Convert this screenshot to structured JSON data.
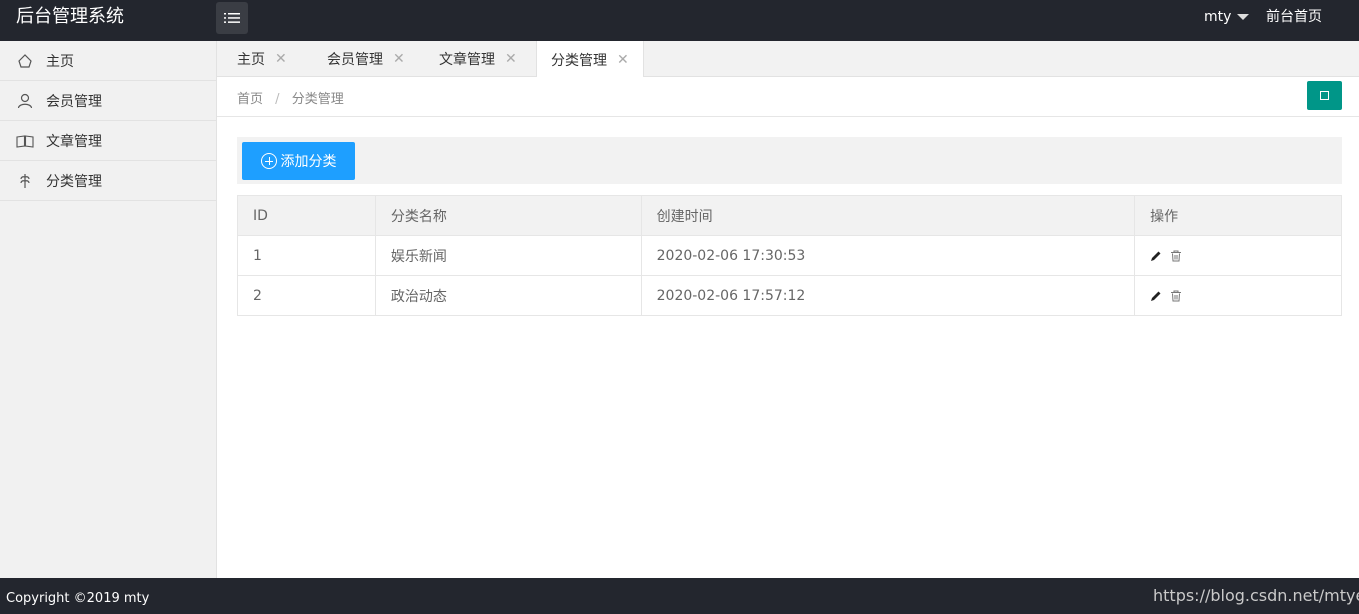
{
  "header": {
    "title": "后台管理系统",
    "user": "mty",
    "front_link": "前台首页"
  },
  "sidebar": {
    "items": [
      {
        "label": "主页",
        "icon": "home-icon"
      },
      {
        "label": "会员管理",
        "icon": "user-icon"
      },
      {
        "label": "文章管理",
        "icon": "book-icon"
      },
      {
        "label": "分类管理",
        "icon": "category-icon"
      }
    ]
  },
  "tabs": [
    {
      "label": "主页",
      "active": false
    },
    {
      "label": "会员管理",
      "active": false
    },
    {
      "label": "文章管理",
      "active": false
    },
    {
      "label": "分类管理",
      "active": true
    }
  ],
  "breadcrumb": {
    "home": "首页",
    "separator": "/",
    "current": "分类管理"
  },
  "toolbar": {
    "add_label": "添加分类"
  },
  "table": {
    "headers": [
      "ID",
      "分类名称",
      "创建时间",
      "操作"
    ],
    "rows": [
      {
        "id": "1",
        "name": "娱乐新闻",
        "created": "2020-02-06 17:30:53"
      },
      {
        "id": "2",
        "name": "政治动态",
        "created": "2020-02-06 17:57:12"
      }
    ]
  },
  "footer": {
    "copyright": "Copyright ©2019 mty",
    "watermark": "https://blog.csdn.net/mtyedu"
  },
  "colors": {
    "header_bg": "#23262e",
    "primary_blue": "#1e9fff",
    "teal": "#009688"
  }
}
